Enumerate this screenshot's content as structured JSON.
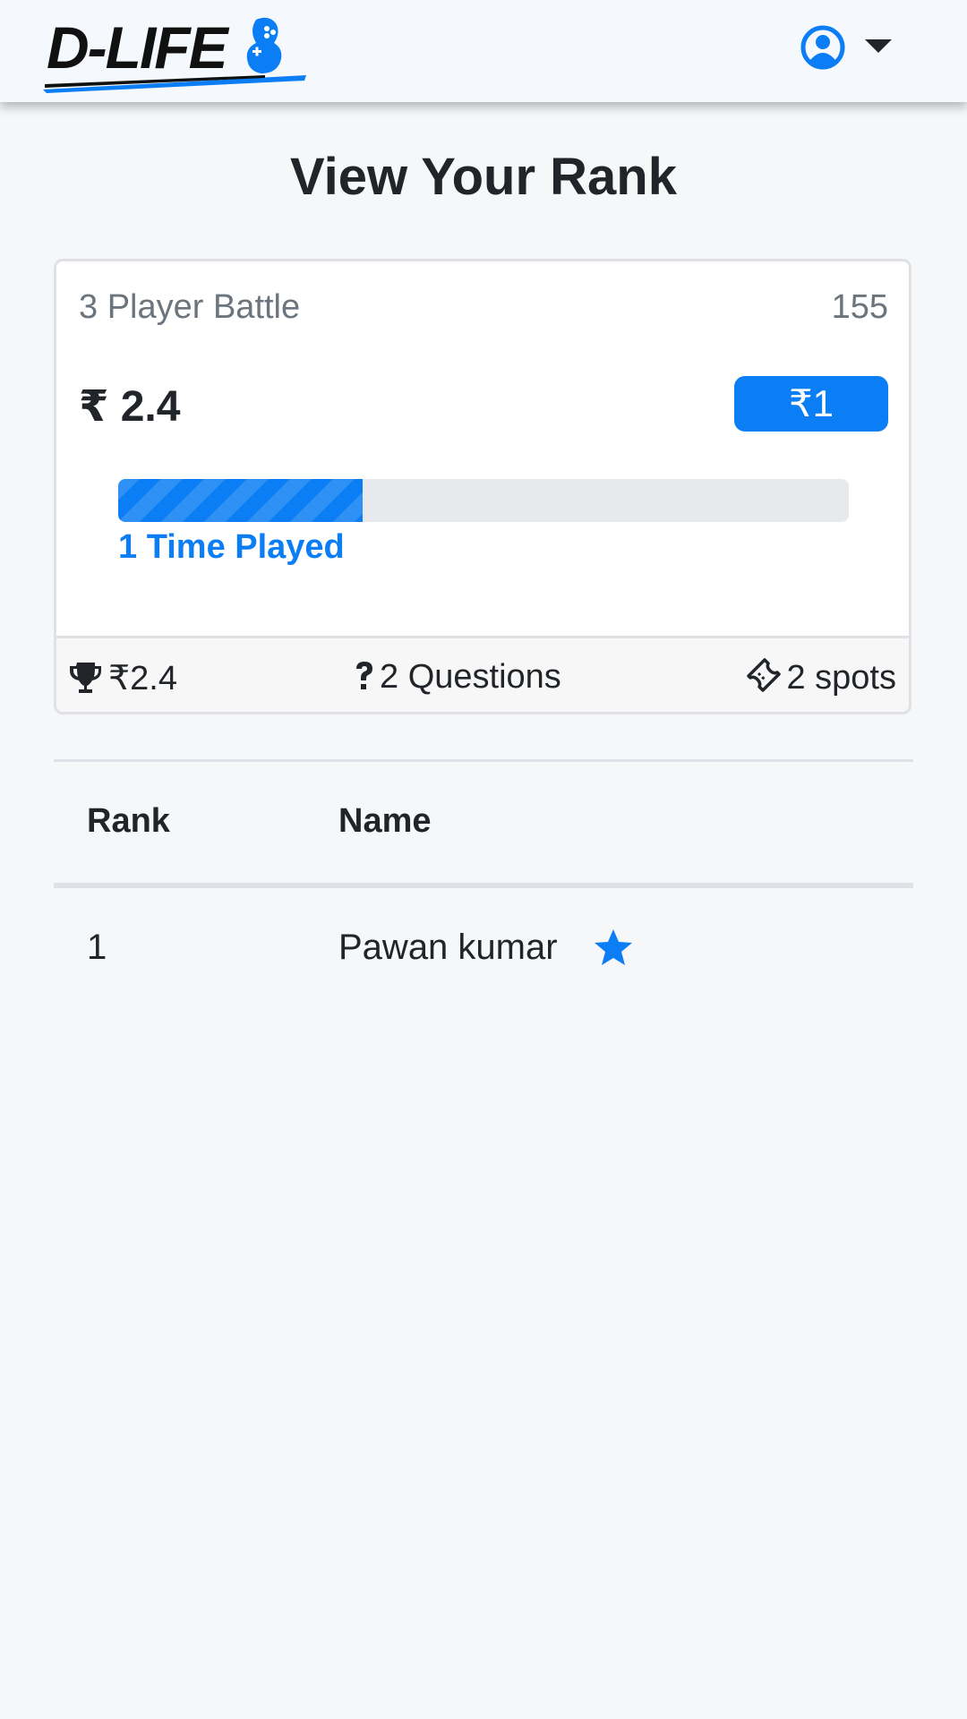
{
  "header": {
    "logo_text": "D-LIFE",
    "colors": {
      "brand": "#0b7df5",
      "nav_bg": "#f5f9fd"
    }
  },
  "page": {
    "title": "View Your Rank"
  },
  "contest": {
    "name": "3 Player Battle",
    "count": "155",
    "prize": "₹ 2.4",
    "entry_fee": "₹1",
    "progress_fraction": 0.335,
    "times_played": "1 Time Played",
    "footer": {
      "prize": "₹2.4",
      "questions": "2 Questions",
      "spots": "2 spots",
      "icons": [
        "trophy-icon",
        "question-icon",
        "ticket-icon"
      ]
    }
  },
  "leaderboard": {
    "columns": [
      "Rank",
      "Name"
    ],
    "rows": [
      {
        "rank": "1",
        "name": "Pawan kumar",
        "icon": "star-icon"
      }
    ]
  }
}
